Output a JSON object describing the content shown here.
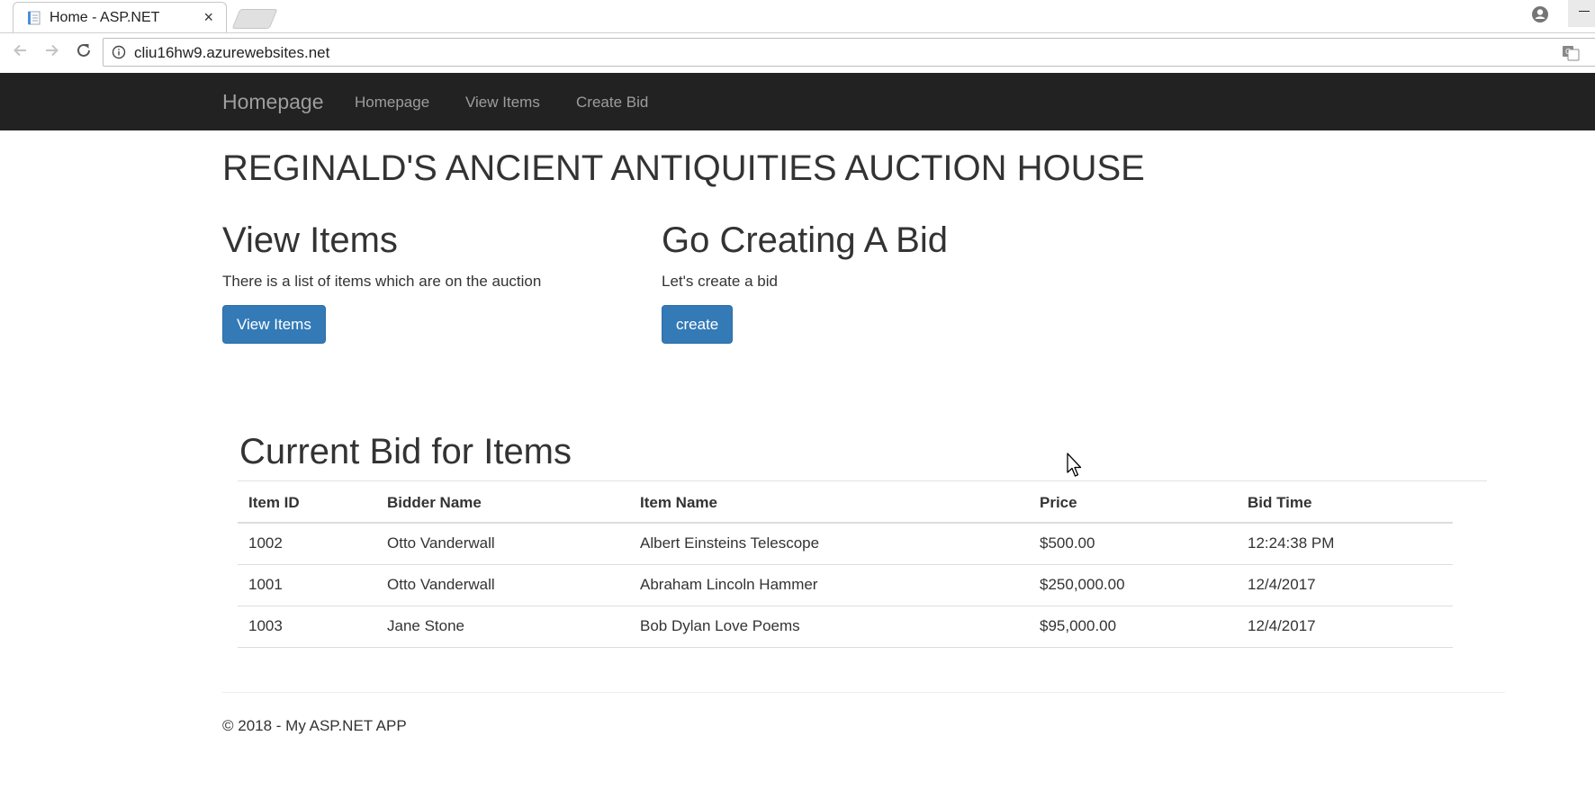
{
  "browser": {
    "tab_title": "Home - ASP.NET",
    "url": "cliu16hw9.azurewebsites.net"
  },
  "navbar": {
    "brand": "Homepage",
    "links": [
      "Homepage",
      "View Items",
      "Create Bid"
    ]
  },
  "page": {
    "title": "REGINALD'S ANCIENT ANTIQUITIES AUCTION HOUSE",
    "view_items": {
      "heading": "View Items",
      "text": "There is a list of items which are on the auction",
      "button": "View Items"
    },
    "create_bid": {
      "heading": "Go Creating A Bid",
      "text": "Let's create a bid",
      "button": "create"
    }
  },
  "bids": {
    "title": "Current Bid for Items",
    "columns": [
      "Item ID",
      "Bidder Name",
      "Item Name",
      "Price",
      "Bid Time"
    ],
    "rows": [
      [
        "1002",
        "Otto Vanderwall",
        "Albert Einsteins Telescope",
        "$500.00",
        "12:24:38 PM"
      ],
      [
        "1001",
        "Otto Vanderwall",
        "Abraham Lincoln Hammer",
        "$250,000.00",
        "12/4/2017"
      ],
      [
        "1003",
        "Jane Stone",
        "Bob Dylan Love Poems",
        "$95,000.00",
        "12/4/2017"
      ]
    ]
  },
  "footer": {
    "text": "© 2018 - My ASP.NET APP"
  },
  "colors": {
    "navbar_bg": "#222222",
    "nav_text": "#9d9d9d",
    "primary_button": "#337ab7"
  }
}
